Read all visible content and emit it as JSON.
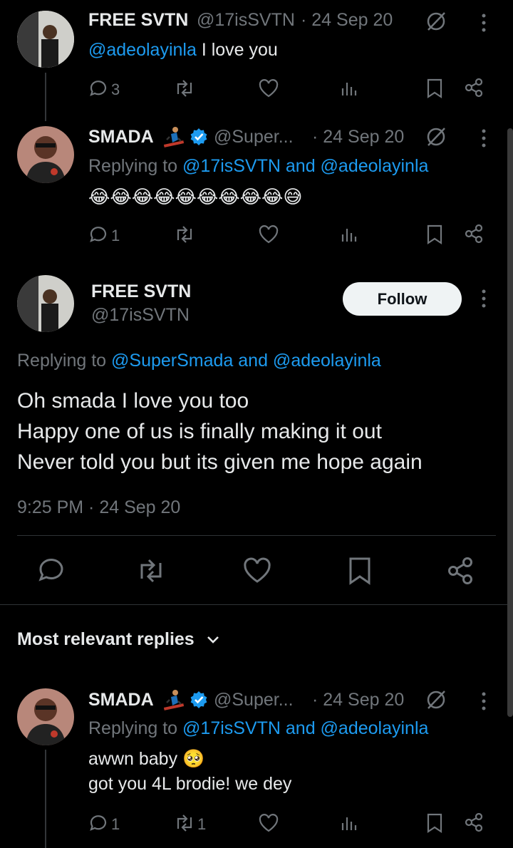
{
  "tweet1": {
    "name": "FREE SVTN",
    "handle": "@17isSVTN",
    "date": "· 24 Sep 20",
    "mention": "@adeolayinla",
    "text": " I love you",
    "reply_count": "3"
  },
  "tweet2": {
    "name": "SMADA",
    "handle": "@Super...",
    "date": "· 24 Sep 20",
    "replying_prefix": "Replying to ",
    "replying_handles": "@17isSVTN and @adeolayinla",
    "emoji_text": "😂😂😂😂😂😂😂😂😂😅",
    "reply_count": "1"
  },
  "main_tweet": {
    "name": "FREE SVTN",
    "handle": "@17isSVTN",
    "follow_label": "Follow",
    "replying_prefix": "Replying to ",
    "replying_handles": "@SuperSmada and @adeolayinla",
    "line1": "Oh smada I love you too",
    "line2": "Happy one of us is finally making it out",
    "line3": "Never told you but its given me hope again",
    "timestamp": "9:25 PM · 24 Sep 20"
  },
  "replies_filter": {
    "label": "Most relevant replies"
  },
  "tweet3": {
    "name": "SMADA",
    "handle": "@Super...",
    "date": "· 24 Sep 20",
    "replying_prefix": "Replying to ",
    "replying_handles": "@17isSVTN and @adeolayinla",
    "line1": "awwn baby 🥺",
    "line2": "got you 4L brodie! we dey",
    "reply_count": "1",
    "retweet_count": "1"
  },
  "colors": {
    "background": "#000000",
    "text": "#e7e9ea",
    "muted": "#71767b",
    "link": "#1d9bf0",
    "verified": "#1d9bf0"
  }
}
